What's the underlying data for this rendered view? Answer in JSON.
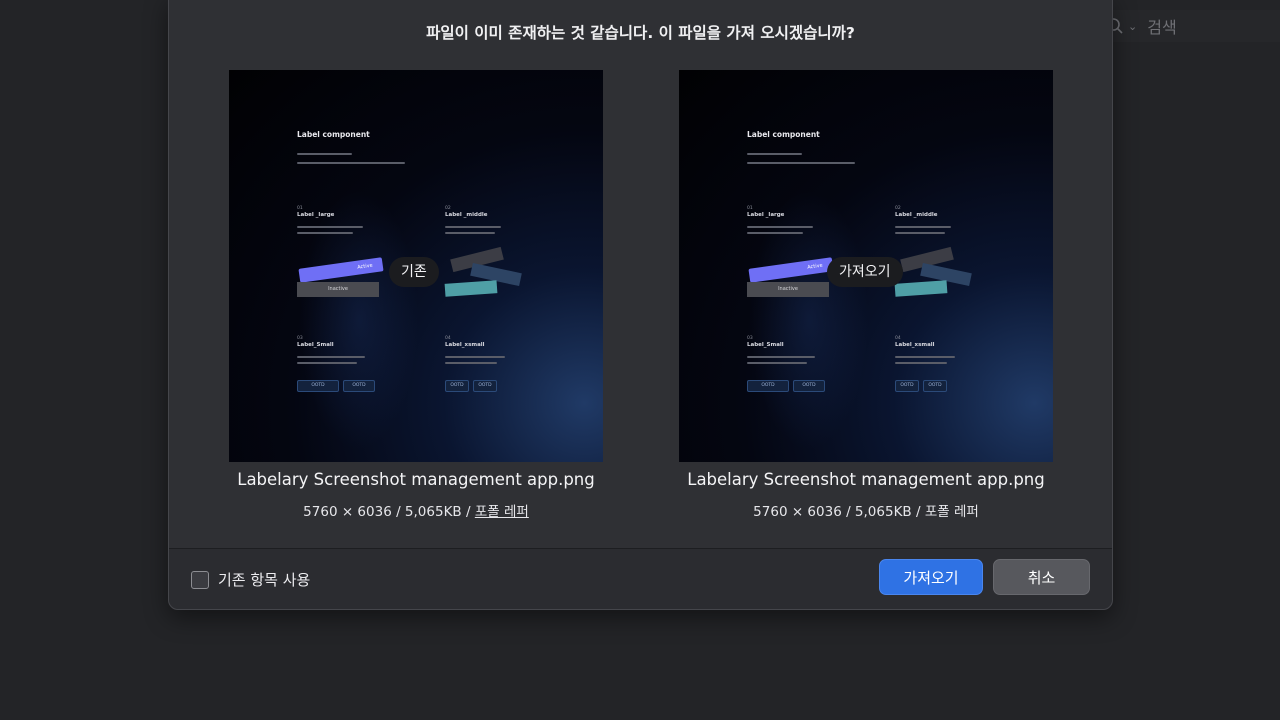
{
  "search": {
    "icon": "search-icon",
    "placeholder": "검색"
  },
  "dialog": {
    "prompt": "파일이 이미 존재하는 것 같습니다. 이 파일을 가져 오시겠습니까?",
    "existing": {
      "overlay_label": "기존",
      "file_name": "Labelary Screenshot management app.png",
      "dimensions": "5760 × 6036",
      "size": "5,065KB",
      "location": "포폴 레퍼"
    },
    "incoming": {
      "overlay_label": "가져오기",
      "file_name": "Labelary Screenshot management app.png",
      "dimensions": "5760 × 6036",
      "size": "5,065KB",
      "location": "포폴 레퍼"
    },
    "footer": {
      "use_existing_label": "기존 항목 사용",
      "use_existing_checked": false,
      "import_button": "가져오기",
      "cancel_button": "취소"
    }
  },
  "thumbnail": {
    "title": "Label component",
    "sections": [
      {
        "num": "01",
        "label": "Label _large"
      },
      {
        "num": "02",
        "label": "Label _middle"
      },
      {
        "num": "03",
        "label": "Label_Small"
      },
      {
        "num": "04",
        "label": "Label_xsmall"
      }
    ],
    "tag_active": "Active",
    "tag_inactive": "Inactive",
    "chip_text": "OOTD",
    "accent_color": "#6f6ff5"
  }
}
